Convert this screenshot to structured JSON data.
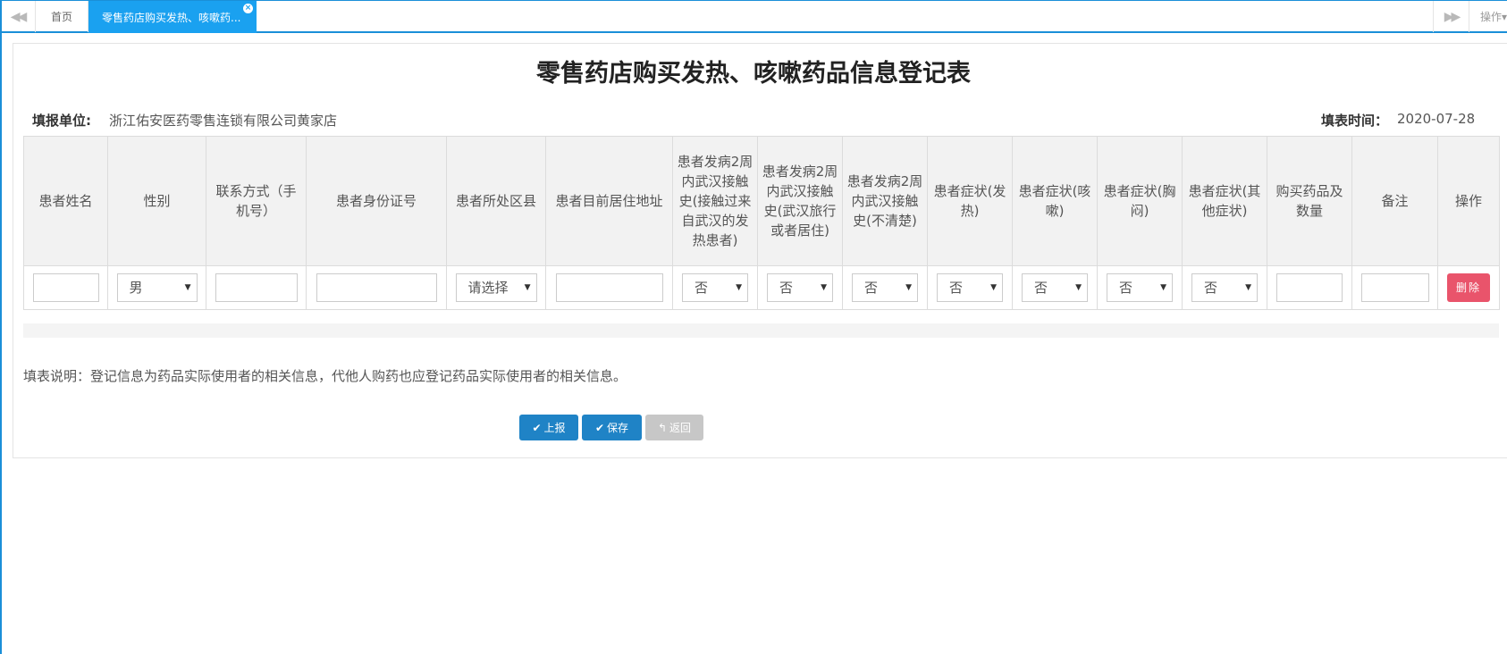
{
  "tabs": {
    "home_label": "首页",
    "active_label": "零售药店购买发热、咳嗽药...",
    "close_glyph": "×",
    "back_glyph": "◀◀",
    "forward_glyph": "▶▶",
    "ops_label": "操作▾"
  },
  "form": {
    "title": "零售药店购买发热、咳嗽药品信息登记表",
    "unit_label": "填报单位:",
    "unit_value": "浙江佑安医药零售连锁有限公司黄家店",
    "date_label": "填表时间：",
    "date_value": "2020-07-28"
  },
  "table": {
    "headers": [
      "患者姓名",
      "性别",
      "联系方式（手机号）",
      "患者身份证号",
      "患者所处区县",
      "患者目前居住地址",
      "患者发病2周内武汉接触史(接触过来自武汉的发热患者)",
      "患者发病2周内武汉接触史(武汉旅行或者居住)",
      "患者发病2周内武汉接触史(不清楚)",
      "患者症状(发热)",
      "患者症状(咳嗽)",
      "患者症状(胸闷)",
      "患者症状(其他症状)",
      "购买药品及数量",
      "备注",
      "操作"
    ],
    "row": {
      "gender": "男",
      "district": "请选择",
      "contact_fever": "否",
      "contact_travel": "否",
      "contact_unknown": "否",
      "symptom_fever": "否",
      "symptom_cough": "否",
      "symptom_chest": "否",
      "symptom_other": "否",
      "delete_label": "删除",
      "caret": "▼"
    }
  },
  "note": "填表说明：登记信息为药品实际使用者的相关信息，代他人购药也应登记药品实际使用者的相关信息。",
  "buttons": {
    "report": "上报",
    "save": "保存",
    "back": "返回",
    "check_glyph": "✔",
    "back_glyph": "↰"
  },
  "colors": {
    "accent": "#1aa1f0",
    "primary_button": "#1f83c6",
    "danger_button": "#e9546b",
    "disabled_button": "#c7c7c7"
  }
}
